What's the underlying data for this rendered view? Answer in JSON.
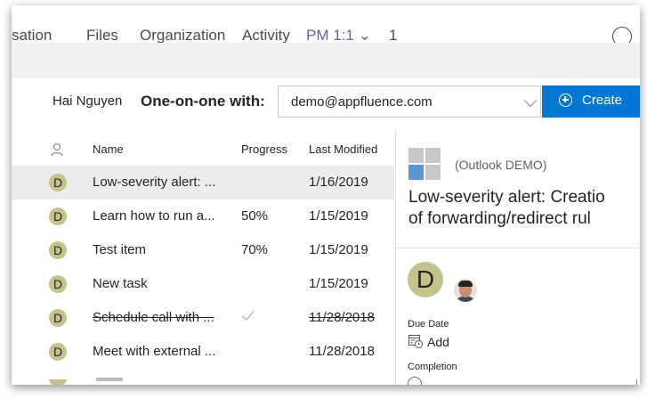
{
  "tabs": [
    {
      "label": "sation"
    },
    {
      "label": "Files"
    },
    {
      "label": "Organization"
    },
    {
      "label": "Activity"
    },
    {
      "label": "PM 1:1 ⌄"
    },
    {
      "label": "1"
    }
  ],
  "colors": {
    "accent": "#6264a7",
    "primary_button": "#0078d4",
    "avatar": "#c4c48a",
    "selected_row": "#ececec"
  },
  "one_on_one": {
    "user_name": "Hai Nguyen",
    "label": "One-on-one with:",
    "email": "demo@appfluence.com",
    "create_label": "Create"
  },
  "list": {
    "columns": {
      "name": "Name",
      "progress": "Progress",
      "modified": "Last Modified"
    },
    "rows": [
      {
        "avatar": "D",
        "name": "Low-severity alert: ...",
        "progress": "",
        "date": "1/16/2019"
      },
      {
        "avatar": "D",
        "name": "Learn how to run a...",
        "progress": "50%",
        "date": "1/15/2019"
      },
      {
        "avatar": "D",
        "name": "Test item",
        "progress": "70%",
        "date": "1/15/2019"
      },
      {
        "avatar": "D",
        "name": "New task",
        "progress": "",
        "date": "1/15/2019"
      },
      {
        "avatar": "D",
        "name": "Schedule call with ...",
        "progress": "",
        "date": "11/28/2018"
      },
      {
        "avatar": "D",
        "name": "Meet with external ...",
        "progress": "",
        "date": "11/28/2018"
      }
    ]
  },
  "detail": {
    "source": "(Outlook DEMO)",
    "title_line1": "Low-severity alert: Creatio",
    "title_line2": "of forwarding/redirect rul",
    "owner_initial": "D",
    "due_date_label": "Due Date",
    "add_label": "Add",
    "completion_label": "Completion"
  }
}
